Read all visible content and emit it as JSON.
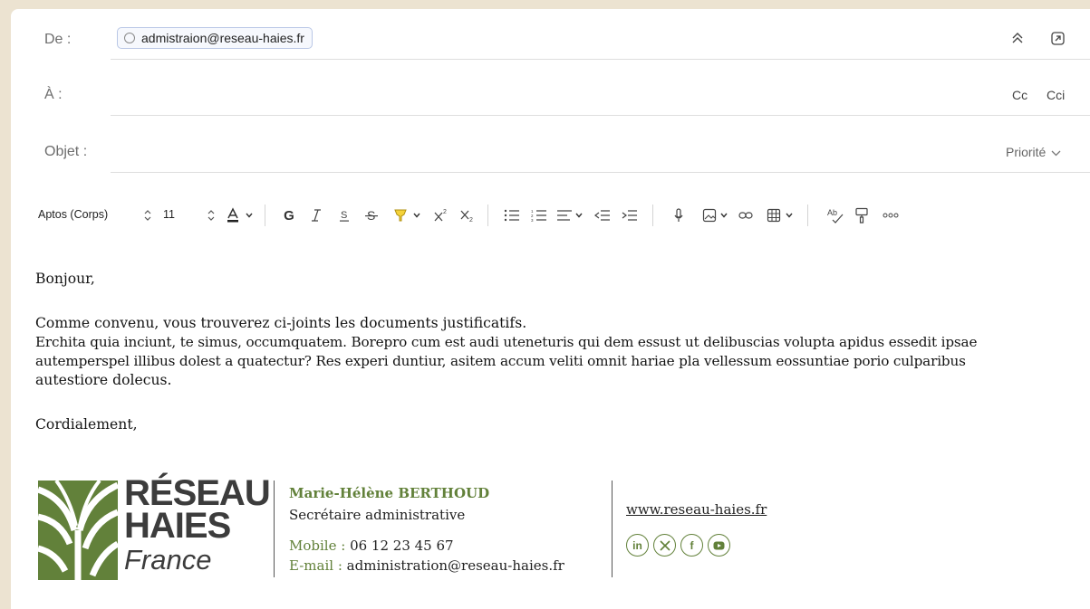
{
  "header": {
    "from_label": "De :",
    "from_value": "admistraion@reseau-haies.fr",
    "to_label": "À :",
    "cc_label": "Cc",
    "bcc_label": "Cci",
    "subject_label": "Objet :",
    "priority_label": "Priorité"
  },
  "toolbar": {
    "font_name": "Aptos (Corps)",
    "font_size": "11"
  },
  "body": {
    "greeting": "Bonjour,",
    "line1": "Comme convenu, vous trouverez ci-joints les documents justificatifs.",
    "line2": "Erchita quia inciunt, te simus, occumquatem. Borepro cum est audi uteneturis qui dem essust ut delibuscias volupta apidus essedit ipsae",
    "line3": "autemperspel illibus dolest a quatectur? Res experi duntiur, asitem accum veliti omnit hariae pla vellessum eossuntiae porio culparibus",
    "line4": "autestiore dolecus.",
    "closing": "Cordialement,"
  },
  "signature": {
    "brand_line1": "RÉSEAU",
    "brand_line2": "HAIES",
    "brand_line3": "France",
    "name": "Marie-Hélène BERTHOUD",
    "role": "Secrétaire administrative",
    "mobile_label": "Mobile :",
    "mobile_value": "06 12 23 45 67",
    "email_label": "E-mail :",
    "email_value": "administration@reseau-haies.fr",
    "website": "www.reseau-haies.fr",
    "social_icons": [
      "linkedin-icon",
      "x-icon",
      "facebook-icon",
      "youtube-icon"
    ]
  },
  "colors": {
    "brand_green": "#62813a",
    "background": "#ece3d1"
  }
}
